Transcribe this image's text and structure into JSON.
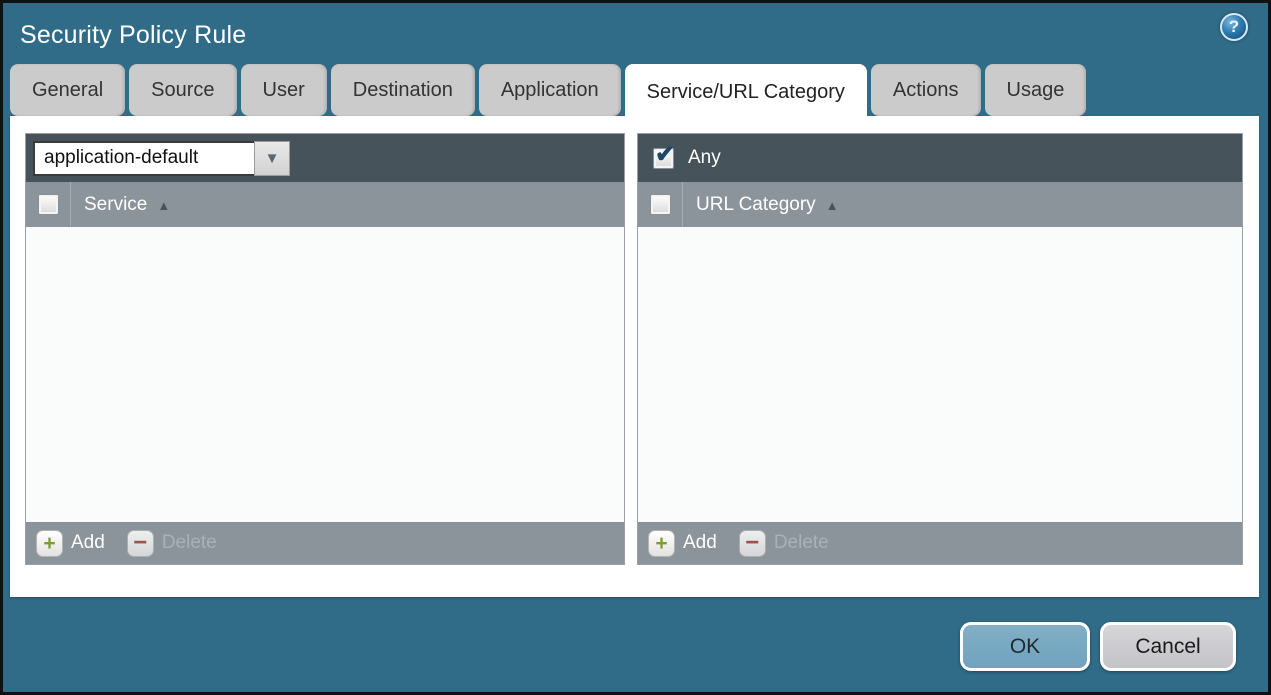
{
  "window": {
    "title": "Security Policy Rule"
  },
  "tabs": [
    {
      "label": "General",
      "active": false
    },
    {
      "label": "Source",
      "active": false
    },
    {
      "label": "User",
      "active": false
    },
    {
      "label": "Destination",
      "active": false
    },
    {
      "label": "Application",
      "active": false
    },
    {
      "label": "Service/URL Category",
      "active": true
    },
    {
      "label": "Actions",
      "active": false
    },
    {
      "label": "Usage",
      "active": false
    }
  ],
  "service_panel": {
    "dropdown_value": "application-default",
    "column_header": "Service",
    "rows": [],
    "add_label": "Add",
    "delete_label": "Delete",
    "delete_enabled": false,
    "select_all_checked": false
  },
  "url_category_panel": {
    "any_label": "Any",
    "any_checked": true,
    "column_header": "URL Category",
    "rows": [],
    "add_label": "Add",
    "delete_label": "Delete",
    "delete_enabled": false,
    "select_all_checked": false
  },
  "actions": {
    "ok_label": "OK",
    "cancel_label": "Cancel"
  },
  "icons": {
    "help": "?",
    "dropdown_arrow": "▼",
    "sort_ascending": "▲",
    "check": "✔",
    "add_plus": "+",
    "delete_minus": "−"
  },
  "colors": {
    "background_teal": "#306C88",
    "toolbar_slate": "#47535B",
    "header_gray": "#8C949B",
    "tab_gray": "#CBCBCB",
    "ok_blue": "#6FA3BE",
    "cancel_gray": "#C9C9CD",
    "add_green": "#7E9B2E",
    "delete_red": "#9B4A3A",
    "check_navy": "#1C4868"
  }
}
